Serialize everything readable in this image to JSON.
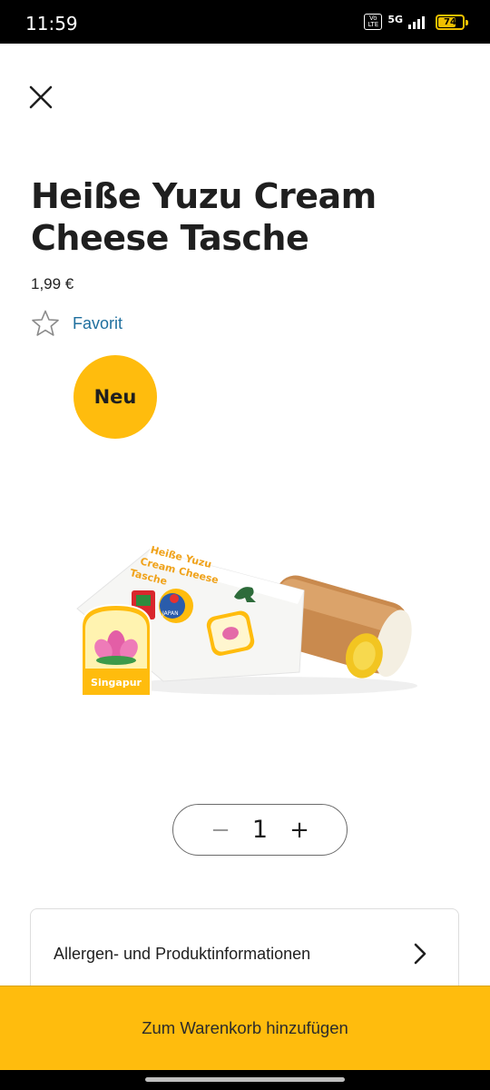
{
  "status_bar": {
    "time": "11:59",
    "volte_label": "Vo LTE",
    "network": "5G",
    "battery_percent": 74,
    "battery_label": "74"
  },
  "product": {
    "title": "Heiße Yuzu Cream Cheese Tasche",
    "price": "1,99 €",
    "favorite_label": "Favorit",
    "badge": "Neu",
    "image_package_text": "Heiße Yuzu Cream Cheese Tasche",
    "image_sticker_text": "Singapur",
    "image_japan_text": "JAPAN"
  },
  "quantity": {
    "minus_symbol": "−",
    "value": "1",
    "plus_symbol": "+"
  },
  "info": {
    "label": "Allergen- und Produktinformationen"
  },
  "cart": {
    "button_label": "Zum Warenkorb hinzufügen"
  },
  "colors": {
    "accent": "#ffbc0d",
    "link": "#1f6f9e",
    "text": "#1f1f1f"
  },
  "icons": {
    "close": "close-icon",
    "favorite": "star-outline-icon",
    "chevron": "chevron-right-icon"
  }
}
